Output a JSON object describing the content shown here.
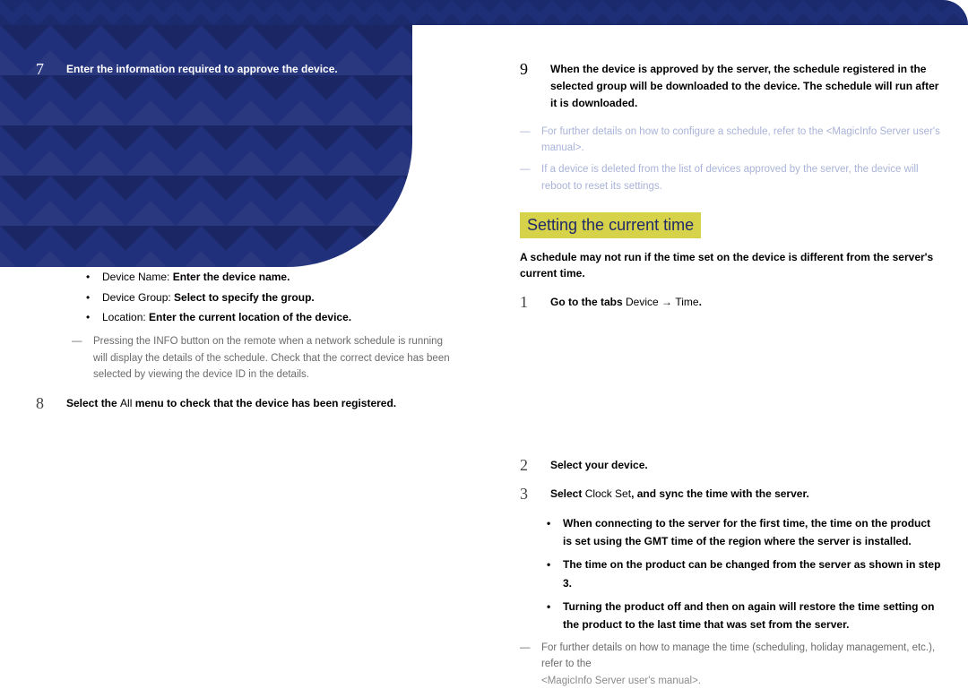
{
  "left": {
    "step7": {
      "num": "7",
      "text": "Enter the information required to approve the device."
    },
    "bullets": [
      {
        "k": "Device Name:",
        "v": "Enter the device name."
      },
      {
        "k": "Device Group:",
        "v": "Select           to specify the group."
      },
      {
        "k": "Location:",
        "v": "Enter the current location of the device."
      }
    ],
    "note1_a": "Pressing the ",
    "note1_kw": "INFO",
    "note1_b": " button on the remote when a network schedule is running will display the details of the schedule. Check that the correct device has been selected by viewing the device ID in the details.",
    "step8": {
      "num": "8",
      "text_a": "Select the ",
      "kw": "All",
      "text_b": " menu to check that the device has been registered."
    }
  },
  "right": {
    "step9": {
      "num": "9",
      "text": "When the device is approved by the server, the schedule registered in the selected group will be downloaded to the device. The schedule will run after it is downloaded."
    },
    "note1": "For further details on how to configure a schedule, refer to the <MagicInfo Server user's manual>.",
    "note2": "If a device is deleted from the list of devices approved by the server, the device will reboot to reset its settings.",
    "section_title": "Setting the current time",
    "lead": "A schedule may not run if the time set on the device is different from the server's current time.",
    "step1": {
      "num": "1",
      "text_a": "Go to the tabs ",
      "kw": "Device",
      "arrow": " → ",
      "kw2": "Time",
      "text_b": "."
    },
    "step2": {
      "num": "2",
      "text": "Select your device."
    },
    "step3": {
      "num": "3",
      "text_a": "Select ",
      "kw": "Clock Set",
      "text_b": ", and sync the time with the server."
    },
    "bullets2": [
      "When connecting to the server for the first time, the time on the product is set using the GMT time of the region where the server is installed.",
      "The time on the product can be changed from the server as shown in step 3.",
      "Turning the product off and then on again will restore the time setting on the product to the last time that was set from the server."
    ],
    "note3_a": "For further details on how to manage the time (scheduling, holiday management, etc.), refer to the ",
    "note3_b": "<MagicInfo Server user's manual>."
  }
}
